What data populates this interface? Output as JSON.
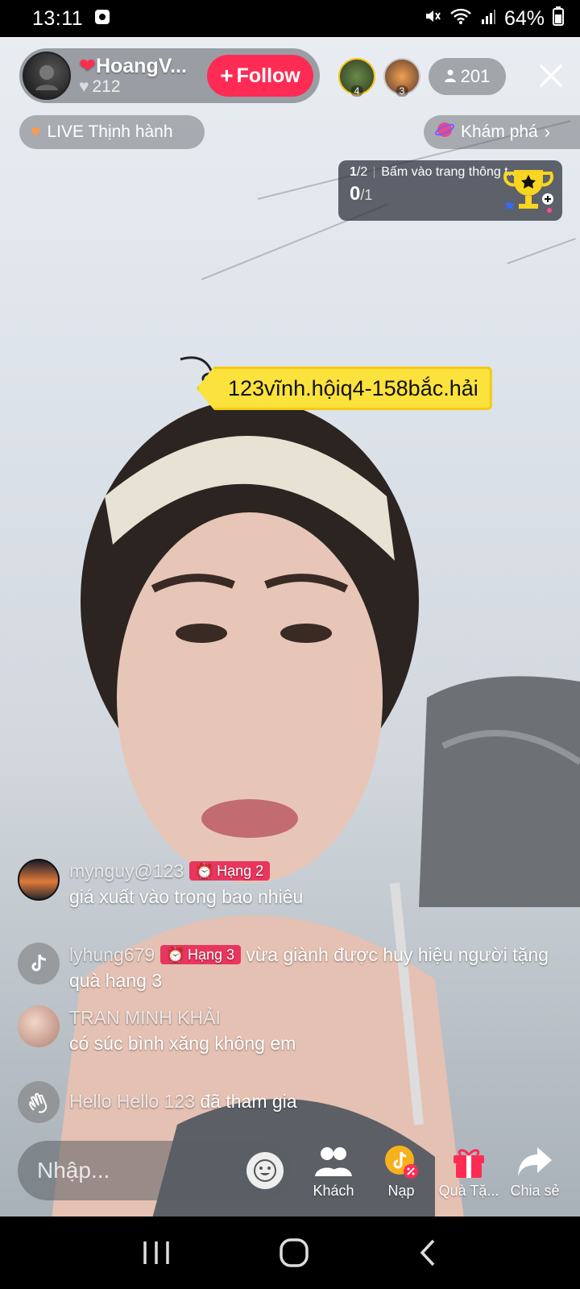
{
  "status_bar": {
    "time": "13:11",
    "battery": "64%"
  },
  "host": {
    "name": "HoangV...",
    "likes": "212",
    "follow_label": "Follow"
  },
  "viewers": {
    "top": [
      {
        "rank": "4"
      },
      {
        "rank": "3"
      }
    ],
    "count": "201"
  },
  "tags": {
    "live_trending": "LIVE Thịnh hành",
    "explore": "Khám phá"
  },
  "task": {
    "step": "1",
    "step_total": "/2",
    "text": "Bấm vào trang thông t...",
    "progress": "0",
    "progress_total": "/1"
  },
  "pinned": {
    "text": "123vĩnh.hộiq4-158bắc.hải"
  },
  "chat": [
    {
      "user": "mynguy@123",
      "badge": "Hạng 2",
      "text": "giá xuất vào trong bao nhiêu"
    },
    {
      "user": "lyhung679",
      "badge": "Hạng 3",
      "text": "vừa giành được huy hiệu người tặng quà hạng 3"
    },
    {
      "user": "TRAN MINH KHẢI",
      "text": "có súc bình xăng không em"
    },
    {
      "user": "Hello Hello 123",
      "text": "đã tham gia"
    }
  ],
  "input": {
    "placeholder": "Nhập..."
  },
  "actions": {
    "guests": "Khách",
    "topup": "Nạp",
    "gifts": "Quà Tặ...",
    "share": "Chia sẻ"
  },
  "colors": {
    "follow": "#fe2c55",
    "pin": "#fbe23c",
    "badge": "#e8365e",
    "gift": "#fe2c55"
  }
}
